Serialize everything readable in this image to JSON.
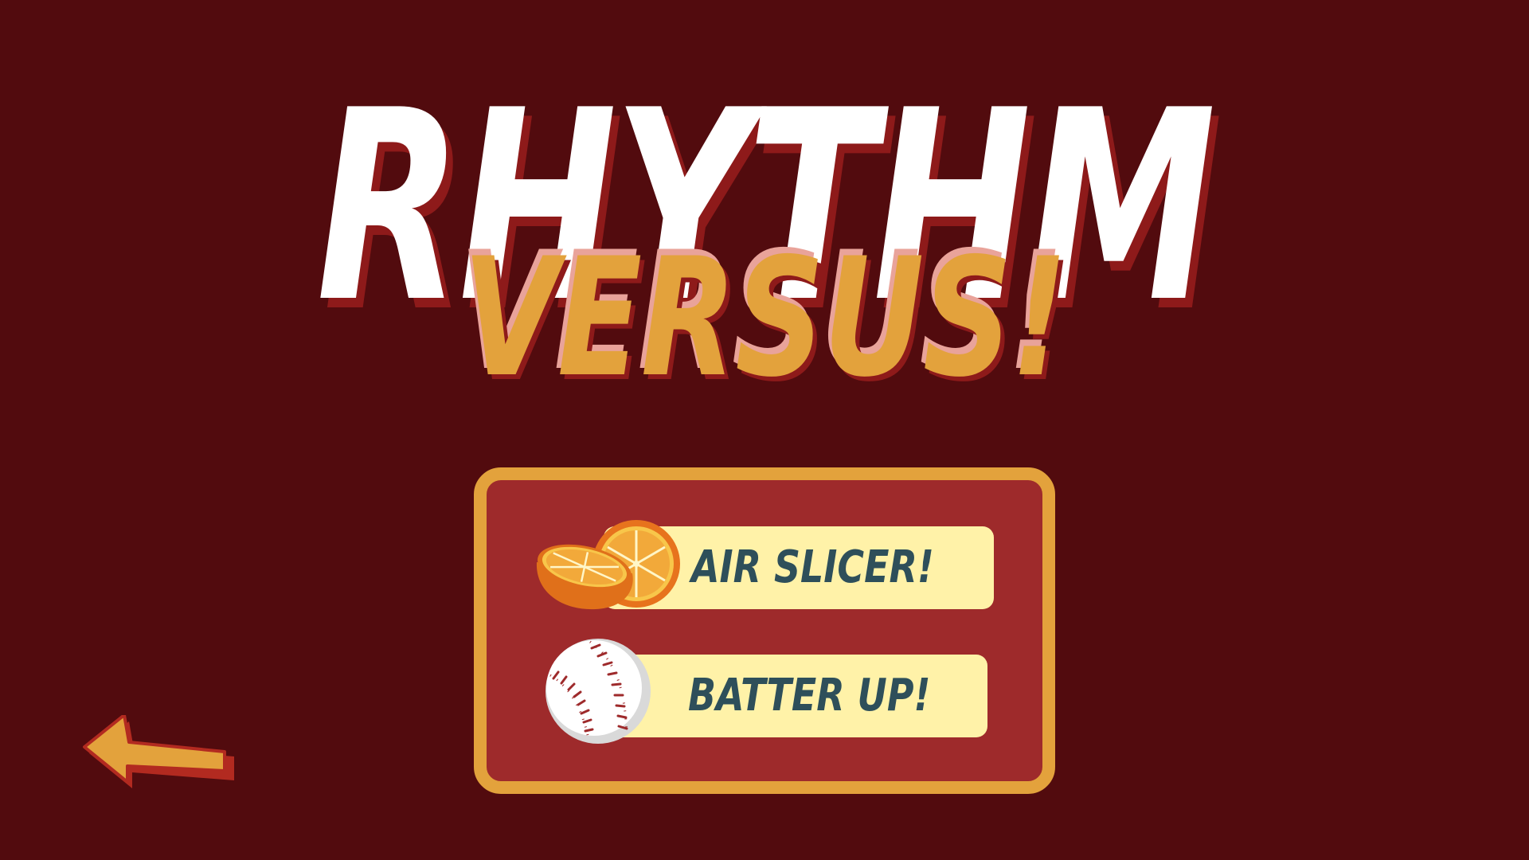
{
  "title": {
    "main": "RHYTHM",
    "sub": "VERSUS!"
  },
  "menu": {
    "items": [
      {
        "label": "AIR SLICER!",
        "icon": "orange-slice-icon"
      },
      {
        "label": "BATTER UP!",
        "icon": "baseball-icon"
      }
    ]
  },
  "navigation": {
    "back_icon": "left-arrow-icon"
  },
  "colors": {
    "background": "#520b0e",
    "title_main": "#ffffff",
    "title_sub": "#e3a23c",
    "title_shadow": "#8e1a1a",
    "panel_fill": "#9e2a2b",
    "panel_border": "#e3a23c",
    "button_fill": "#fff2a8",
    "button_text": "#2e4f5a"
  }
}
